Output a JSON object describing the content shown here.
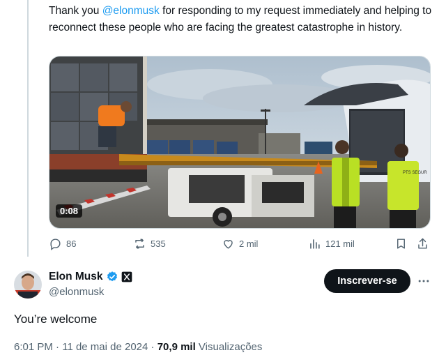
{
  "quoted_tweet": {
    "text_before": "Thank you ",
    "mention": "@elonmusk",
    "text_after": " for responding to my request immediately and helping to reconnect these people who are facing the greatest catastrophe in history.",
    "video": {
      "duration": "0:08",
      "description": "",
      "vest_text": "PTS SEGUR"
    },
    "actions": {
      "replies": "86",
      "retweets": "535",
      "likes": "2 mil",
      "views": "121 mil"
    }
  },
  "reply_tweet": {
    "author_name": "Elon Musk",
    "author_handle": "@elonmusk",
    "subscribe_label": "Inscrever-se",
    "text": "You’re welcome",
    "time": "6:01 PM",
    "separator": " · ",
    "date": "11 de mai de 2024",
    "views_count": "70,9 mil",
    "views_label": " Visualizações"
  },
  "colors": {
    "accent": "#1d9bf0",
    "text_primary": "#0f1419",
    "text_secondary": "#536471",
    "verified": "#1d9bf0"
  },
  "icons": [
    "reply-icon",
    "retweet-icon",
    "like-icon",
    "views-icon",
    "bookmark-icon",
    "share-icon",
    "verified-badge-icon",
    "x-logo-icon",
    "more-icon"
  ]
}
